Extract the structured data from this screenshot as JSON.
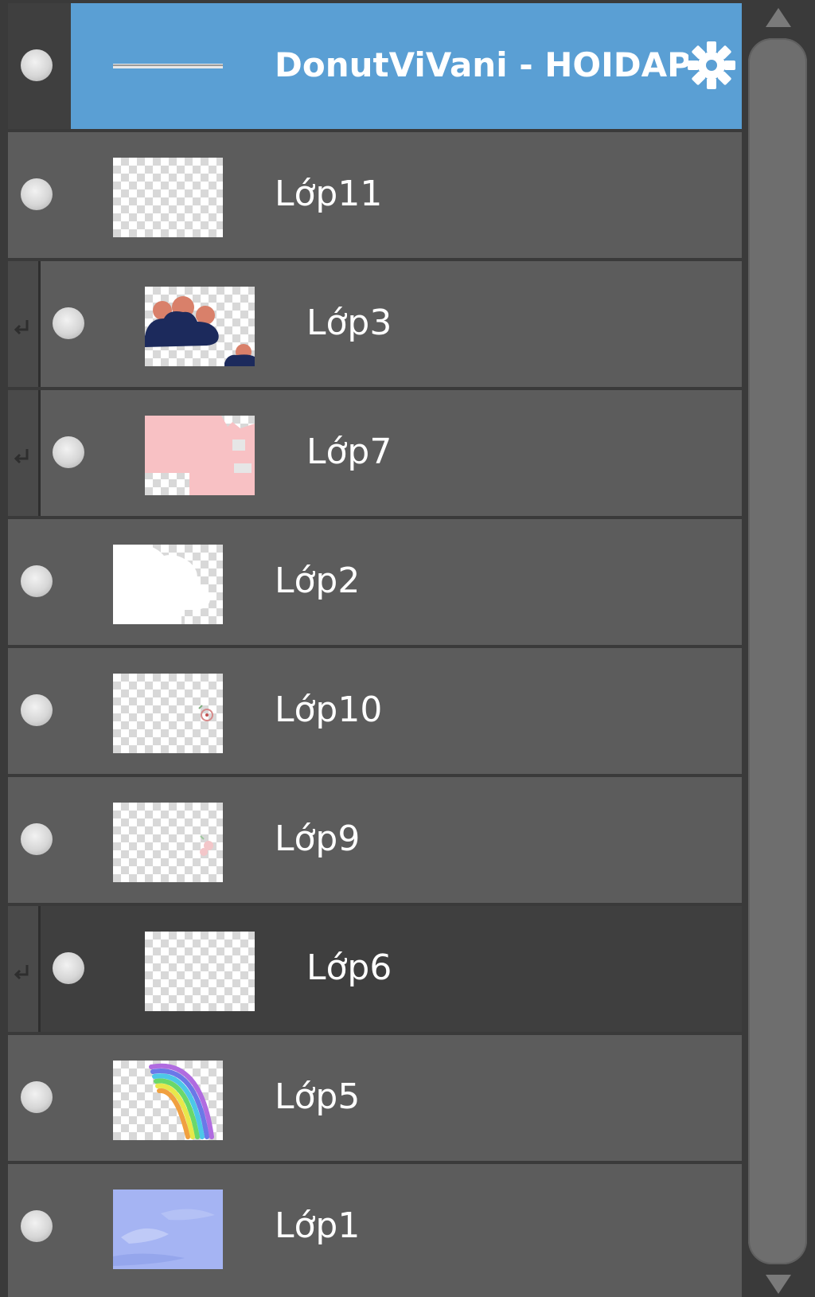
{
  "layers_panel": {
    "layers": [
      {
        "name": "DonutViVani - HOIDAP",
        "selected": true,
        "clipped": false,
        "thumb": "sketch-line"
      },
      {
        "name": "Lớp11",
        "selected": false,
        "clipped": false,
        "thumb": "empty"
      },
      {
        "name": "Lớp3",
        "selected": false,
        "clipped": true,
        "thumb": "navy-clouds"
      },
      {
        "name": "Lớp7",
        "selected": false,
        "clipped": true,
        "thumb": "pink-fill"
      },
      {
        "name": "Lớp2",
        "selected": false,
        "clipped": false,
        "thumb": "white-clouds"
      },
      {
        "name": "Lớp10",
        "selected": false,
        "clipped": false,
        "thumb": "small-mark"
      },
      {
        "name": "Lớp9",
        "selected": false,
        "clipped": false,
        "thumb": "small-flower"
      },
      {
        "name": "Lớp6",
        "selected": true,
        "clipped": true,
        "thumb": "empty"
      },
      {
        "name": "Lớp5",
        "selected": false,
        "clipped": false,
        "thumb": "rainbow"
      },
      {
        "name": "Lớp1",
        "selected": false,
        "clipped": false,
        "thumb": "blue-sky"
      }
    ],
    "icons": {
      "visibility": "visibility-dot-icon",
      "clip": "clip-arrow-icon",
      "settings": "gear-icon"
    },
    "colors": {
      "selected_row": "#5a9fd4",
      "row": "#5c5c5c",
      "background": "#3a3a3a"
    }
  }
}
